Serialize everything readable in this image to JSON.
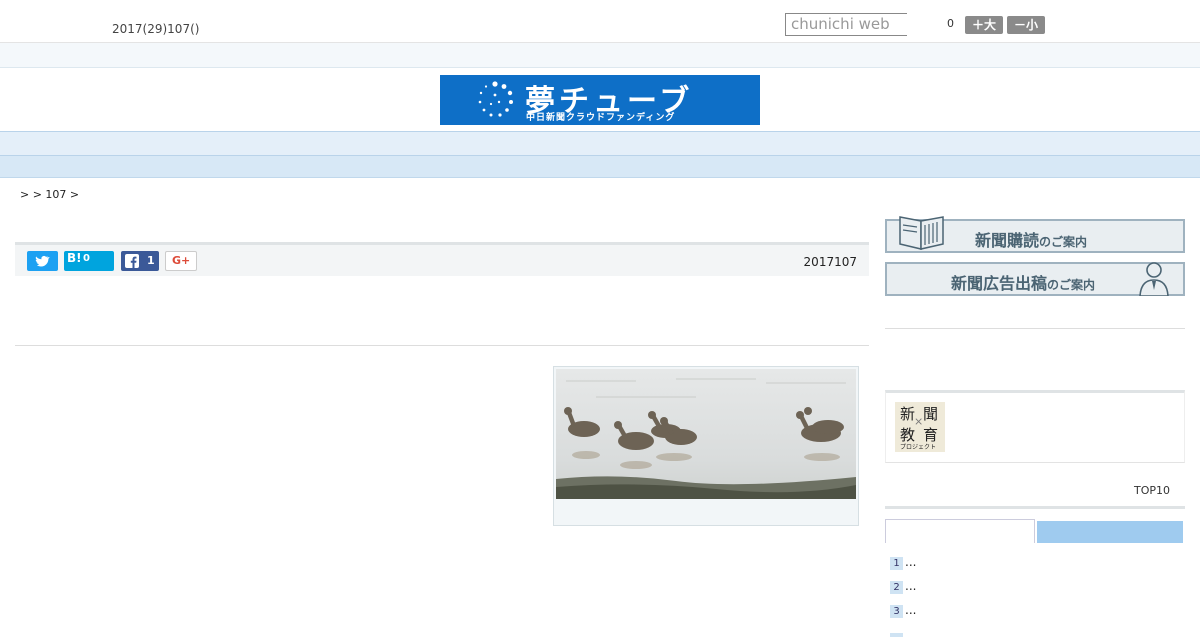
{
  "header": {
    "date": "2017(29)107()",
    "search_placeholder": "chunichi web",
    "fontsize_value": "0",
    "btn_large": "＋大",
    "btn_small": "－小"
  },
  "banner": {
    "title": "夢チューブ",
    "subtitle": "中日新聞クラウドファンディング",
    "color": "#0e6fc7"
  },
  "nav": {
    "items": [
      "",
      "",
      "",
      "",
      "",
      "",
      "",
      "",
      ""
    ]
  },
  "breadcrumb": ">  > 107 >",
  "share": {
    "twitter_icon": "twitter-icon",
    "hatena_label": "B!",
    "hatena_count": "0",
    "facebook_count": "1",
    "gplus_label": "G+",
    "article_date": "2017107"
  },
  "sidebar": {
    "subscribe_main": "新聞購読",
    "subscribe_tail": "のご案内",
    "ad_main": "新聞広告出稿",
    "ad_tail": "のご案内",
    "edu_chars": [
      "新",
      "聞",
      "×",
      "教",
      "育"
    ],
    "edu_caption": "プロジェクト",
    "top10": "TOP10",
    "ranking": [
      "1",
      "2",
      "3"
    ],
    "ranking_text": "..."
  }
}
